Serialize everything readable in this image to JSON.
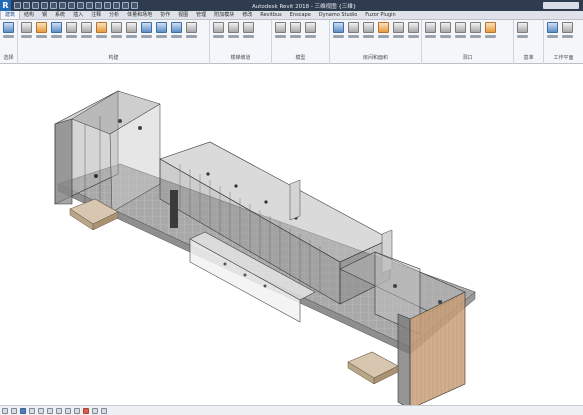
{
  "app": {
    "logo_letter": "R",
    "window_title": "Autodesk Revit 2018 - 三维视图 {三维}"
  },
  "ribbon_tabs": [
    {
      "label": "建筑",
      "active": true
    },
    {
      "label": "结构",
      "active": false
    },
    {
      "label": "钢",
      "active": false
    },
    {
      "label": "系统",
      "active": false
    },
    {
      "label": "插入",
      "active": false
    },
    {
      "label": "注释",
      "active": false
    },
    {
      "label": "分析",
      "active": false
    },
    {
      "label": "体量和场地",
      "active": false
    },
    {
      "label": "协作",
      "active": false
    },
    {
      "label": "视图",
      "active": false
    },
    {
      "label": "管理",
      "active": false
    },
    {
      "label": "附加模块",
      "active": false
    },
    {
      "label": "修改",
      "active": false
    },
    {
      "label": "Revitbus",
      "active": false
    },
    {
      "label": "Enscape",
      "active": false
    },
    {
      "label": "Dynamo Studio",
      "active": false
    },
    {
      "label": "Fuzor Plugin",
      "active": false
    }
  ],
  "ribbon_panels": [
    {
      "title": "选择"
    },
    {
      "title": "构建"
    },
    {
      "title": "楼梯坡道"
    },
    {
      "title": "模型"
    },
    {
      "title": "房间和面积"
    },
    {
      "title": "洞口"
    },
    {
      "title": "基准"
    },
    {
      "title": "工作平面"
    }
  ],
  "theme": {
    "titlebar_bg": "#2f3b4e",
    "ribbon_bg": "#f4f6f9",
    "accent": "#1e6bb8",
    "model_glass": "#8c8c8c",
    "floor": "#a0a0a0",
    "wood_panel": "#c89a6a"
  }
}
